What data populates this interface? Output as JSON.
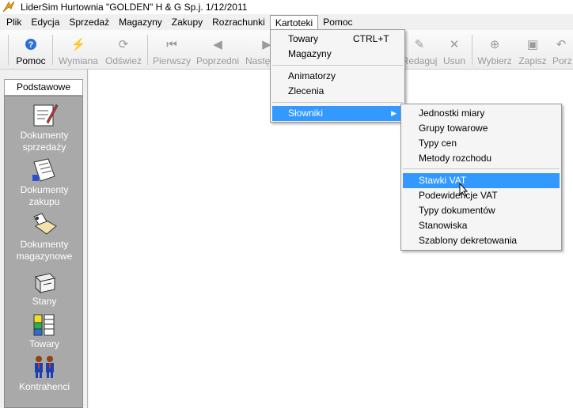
{
  "window": {
    "title": "LiderSim  Hurtownia \"GOLDEN\" H & G Sp.j. 1/12/2011"
  },
  "menubar": [
    {
      "label": "Plik"
    },
    {
      "label": "Edycja"
    },
    {
      "label": "Sprzedaż"
    },
    {
      "label": "Magazyny"
    },
    {
      "label": "Zakupy"
    },
    {
      "label": "Rozrachunki"
    },
    {
      "label": "Kartoteki"
    },
    {
      "label": "Pomoc"
    }
  ],
  "toolbar": {
    "pomoc": "Pomoc",
    "wymiana": "Wymiana",
    "odswiez": "Odśwież",
    "pierwszy": "Pierwszy",
    "poprzedni": "Poprzedni",
    "nastepny": "Nastę",
    "redaguj": "Redaguj",
    "usun": "Usun",
    "wybierz": "Wybierz",
    "zapisz": "Zapisz",
    "porzuc": "Porz"
  },
  "sidebar": {
    "header": "Podstawowe",
    "items": [
      {
        "line1": "Dokumenty",
        "line2": "sprzedaży"
      },
      {
        "line1": "Dokumenty",
        "line2": "zakupu"
      },
      {
        "line1": "Dokumenty",
        "line2": "magazynowe"
      },
      {
        "line1": "Stany",
        "line2": ""
      },
      {
        "line1": "Towary",
        "line2": ""
      },
      {
        "line1": "Kontrahenci",
        "line2": ""
      }
    ]
  },
  "kartoteki_menu": {
    "towary": "Towary",
    "towary_shortcut": "CTRL+T",
    "magazyny": "Magazyny",
    "animatorzy": "Animatorzy",
    "zlecenia": "Zlecenia",
    "slowniki": "Słowniki"
  },
  "slowniki_menu": [
    "Jednostki miary",
    "Grupy towarowe",
    "Typy cen",
    "Metody rozchodu",
    "Stawki VAT",
    "Podewidencje VAT",
    "Typy dokumentów",
    "Stanowiska",
    "Szablony dekretowania"
  ],
  "colors": {
    "highlight": "#3399ff",
    "sidebar_panel": "#a9a9a9"
  }
}
